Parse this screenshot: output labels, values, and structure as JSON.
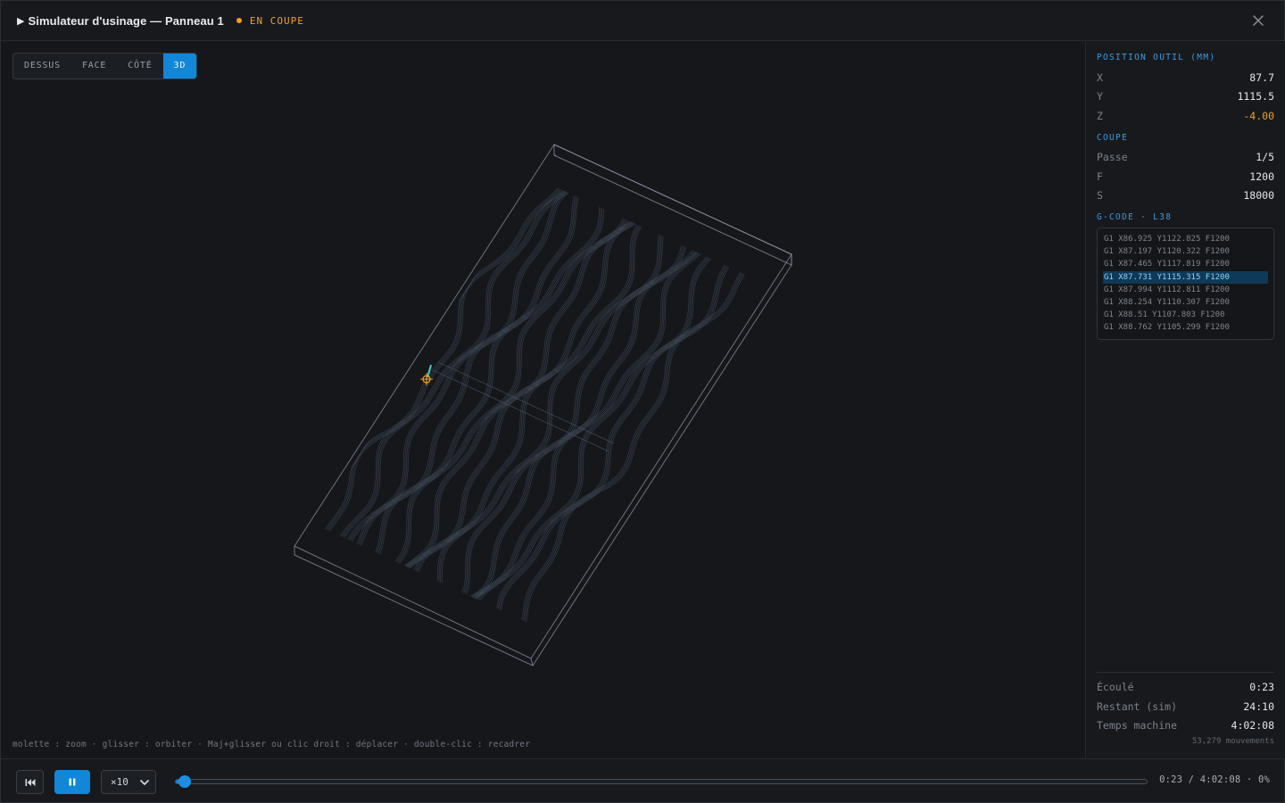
{
  "header": {
    "title": "Simulateur d'usinage — Panneau 1",
    "status": "EN COUPE",
    "status_color": "#f0a12a"
  },
  "view_tabs": [
    {
      "label": "DESSUS",
      "active": false
    },
    {
      "label": "FACE",
      "active": false
    },
    {
      "label": "CÔTÉ",
      "active": false
    },
    {
      "label": "3D",
      "active": true
    }
  ],
  "hint": "molette : zoom · glisser : orbiter · Maj+glisser ou clic droit : déplacer · double-clic : recadrer",
  "position": {
    "title": "POSITION OUTIL (MM)",
    "x_label": "X",
    "x": "87.7",
    "y_label": "Y",
    "y": "1115.5",
    "z_label": "Z",
    "z": "-4.00"
  },
  "cut": {
    "title": "COUPE",
    "pass_label": "Passe",
    "pass": "1/5",
    "feed_label": "F",
    "feed": "1200",
    "speed_label": "S",
    "speed": "18000"
  },
  "gcode": {
    "title": "G-CODE · L38",
    "current_index": 3,
    "lines": [
      "G1 X86.925 Y1122.825 F1200",
      "G1 X87.197 Y1120.322 F1200",
      "G1 X87.465 Y1117.819 F1200",
      "G1 X87.731 Y1115.315 F1200",
      "G1 X87.994 Y1112.811 F1200",
      "G1 X88.254 Y1110.307 F1200",
      "G1 X88.51 Y1107.803 F1200",
      "G1 X88.762 Y1105.299 F1200"
    ]
  },
  "times": {
    "elapsed_label": "Écoulé",
    "elapsed": "0:23",
    "remaining_label": "Restant (sim)",
    "remaining": "24:10",
    "machine_label": "Temps machine",
    "machine": "4:02:08",
    "moves": "53,279 mouvements"
  },
  "playback": {
    "speed": "×10",
    "progress": 0.005,
    "readout": "0:23 / 4:02:08 · 0%"
  },
  "colors": {
    "accent": "#1287d8",
    "warning": "#f0a12a",
    "background": "#15171b"
  },
  "icons": {
    "play": "play-icon",
    "close": "close-icon",
    "rewind": "skip-back-icon",
    "pause": "pause-icon",
    "chevron": "chevron-down-icon",
    "tool": "tool-crosshair-icon"
  }
}
